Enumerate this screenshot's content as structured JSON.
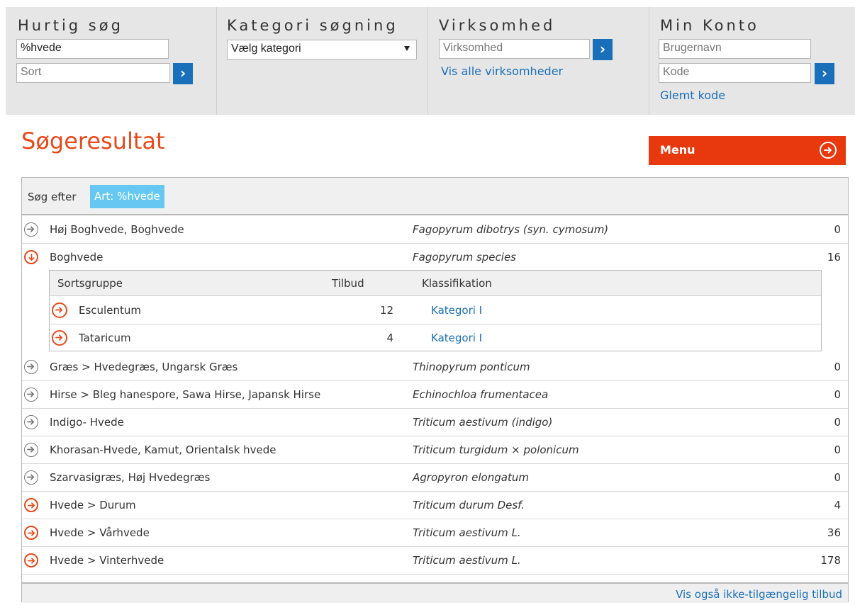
{
  "quick_search": {
    "title": "Hurtig søg",
    "query_value": "%hvede",
    "sort_placeholder": "Sort"
  },
  "category_search": {
    "title": "Kategori søgning",
    "selected": "Vælg kategori"
  },
  "company": {
    "title": "Virksomhed",
    "placeholder": "Virksomhed",
    "show_all_link": "Vis alle virksomheder"
  },
  "account": {
    "title": "Min Konto",
    "username_placeholder": "Brugernavn",
    "password_placeholder": "Kode",
    "forgot_link": "Glemt kode"
  },
  "results": {
    "title": "Søgeresultat",
    "menu_label": "Menu",
    "search_for_label": "Søg efter",
    "filter_chip": "Art: %hvede",
    "footer_link": "Vis også ikke-tilgængelig tilbud",
    "rows": [
      {
        "name": "Høj Boghvede, Boghvede",
        "latin": "Fagopyrum dibotrys (syn. cymosum)",
        "count": "0",
        "icon": "arrow-right-circle-icon"
      },
      {
        "name": "Boghvede",
        "latin": "Fagopyrum species",
        "count": "16",
        "icon": "arrow-down-circle-icon"
      },
      {
        "name": "Græs > Hvedegræs, Ungarsk Græs",
        "latin": "Thinopyrum ponticum",
        "count": "0",
        "icon": "arrow-right-circle-icon"
      },
      {
        "name": "Hirse > Bleg hanespore, Sawa Hirse, Japansk Hirse",
        "latin": "Echinochloa frumentacea",
        "count": "0",
        "icon": "arrow-right-circle-icon"
      },
      {
        "name": "Indigo- Hvede",
        "latin": "Triticum aestivum (indigo)",
        "count": "0",
        "icon": "arrow-right-circle-icon"
      },
      {
        "name": "Khorasan-Hvede, Kamut, Orientalsk hvede",
        "latin": "Triticum turgidum × polonicum",
        "count": "0",
        "icon": "arrow-right-circle-icon"
      },
      {
        "name": "Szarvasigræs, Høj Hvedegræs",
        "latin": "Agropyron elongatum",
        "count": "0",
        "icon": "arrow-right-circle-icon"
      },
      {
        "name": "Hvede > Durum",
        "latin": "Triticum durum Desf.",
        "count": "4",
        "icon": "arrow-right-circle-icon"
      },
      {
        "name": "Hvede > Vårhvede",
        "latin": "Triticum aestivum L.",
        "count": "36",
        "icon": "arrow-right-circle-icon"
      },
      {
        "name": "Hvede > Vinterhvede",
        "latin": "Triticum aestivum L.",
        "count": "178",
        "icon": "arrow-right-circle-icon"
      }
    ],
    "subtable": {
      "headers": {
        "group": "Sortsgruppe",
        "offers": "Tilbud",
        "classification": "Klassifikation"
      },
      "rows": [
        {
          "name": "Esculentum",
          "offers": "12",
          "classification": "Kategori I"
        },
        {
          "name": "Tataricum",
          "offers": "4",
          "classification": "Kategori I"
        }
      ]
    }
  },
  "colors": {
    "accent_orange": "#e8491a",
    "menu_orange": "#e8380d",
    "link_blue": "#1a6fba",
    "chip_blue": "#66c8f2",
    "header_gray": "#e6e6e6"
  }
}
